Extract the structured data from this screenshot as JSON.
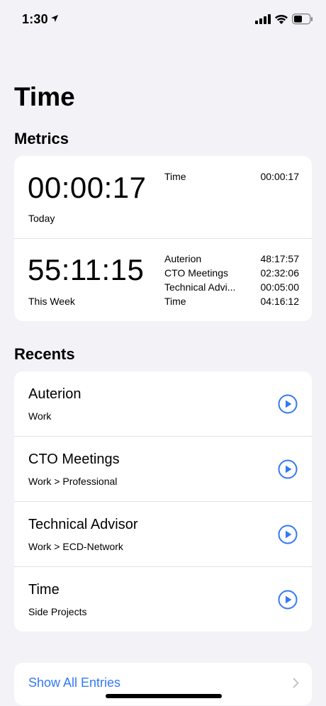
{
  "status": {
    "time": "1:30"
  },
  "title": "Time",
  "metrics": {
    "header": "Metrics",
    "today": {
      "big": "00:00:17",
      "caption": "Today",
      "items": [
        {
          "label": "Time",
          "value": "00:00:17"
        }
      ]
    },
    "week": {
      "big": "55:11:15",
      "caption": "This Week",
      "items": [
        {
          "label": "Auterion",
          "value": "48:17:57"
        },
        {
          "label": "CTO Meetings",
          "value": "02:32:06"
        },
        {
          "label": "Technical Advi...",
          "value": "00:05:00"
        },
        {
          "label": "Time",
          "value": "04:16:12"
        }
      ]
    }
  },
  "recents": {
    "header": "Recents",
    "items": [
      {
        "title": "Auterion",
        "subtitle": "Work"
      },
      {
        "title": "CTO Meetings",
        "subtitle": "Work > Professional"
      },
      {
        "title": "Technical Advisor",
        "subtitle": "Work > ECD-Network"
      },
      {
        "title": "Time",
        "subtitle": "Side Projects"
      }
    ]
  },
  "show_all": {
    "label": "Show All Entries"
  },
  "colors": {
    "accent": "#3478f6",
    "background": "#f2f2f7",
    "card": "#ffffff"
  }
}
